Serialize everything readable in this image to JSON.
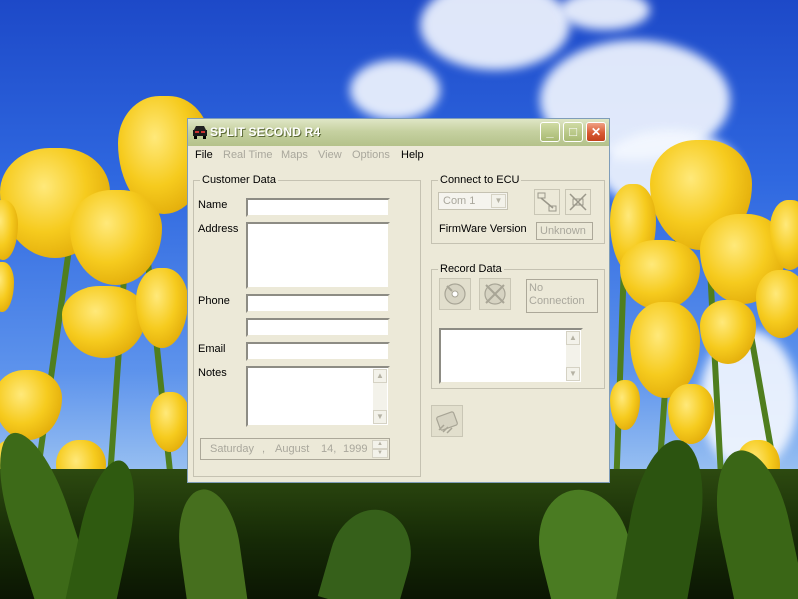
{
  "window": {
    "title": "SPLIT SECOND R4",
    "minimize_glyph": "_",
    "maximize_glyph": "□",
    "close_glyph": "✕"
  },
  "menu": [
    {
      "label": "File",
      "enabled": true
    },
    {
      "label": "Real Time",
      "enabled": false
    },
    {
      "label": "Maps",
      "enabled": false
    },
    {
      "label": "View",
      "enabled": false
    },
    {
      "label": "Options",
      "enabled": false
    },
    {
      "label": "Help",
      "enabled": true
    }
  ],
  "customer": {
    "group_title": "Customer Data",
    "name_label": "Name",
    "address_label": "Address",
    "phone_label": "Phone",
    "email_label": "Email",
    "notes_label": "Notes",
    "name_value": "",
    "address_value": "",
    "phone_value": "",
    "phone2_value": "",
    "email_value": "",
    "notes_value": "",
    "date": {
      "weekday": "Saturday",
      "sep": ",",
      "month": "August",
      "day": "14,",
      "year": "1999"
    }
  },
  "ecu": {
    "group_title": "Connect to ECU",
    "port_value": "Com 1",
    "firmware_label": "FirmWare Version",
    "firmware_value": "Unknown",
    "connect_icon": "plug-connect-icon",
    "disconnect_icon": "plug-disconnect-icon"
  },
  "record": {
    "group_title": "Record Data",
    "status_line1": "No",
    "status_line2": "Connection",
    "log_value": "",
    "record_icon": "record-disk-icon",
    "stop_icon": "stop-disk-icon"
  },
  "bottom": {
    "chip_icon": "chip-icon"
  },
  "colors": {
    "window_face": "#ece9d8",
    "title_gradient_top": "#dfe6c6",
    "title_gradient_bottom": "#b4c28a",
    "close_button": "#d85a33",
    "disabled_text": "#a9a79c"
  }
}
